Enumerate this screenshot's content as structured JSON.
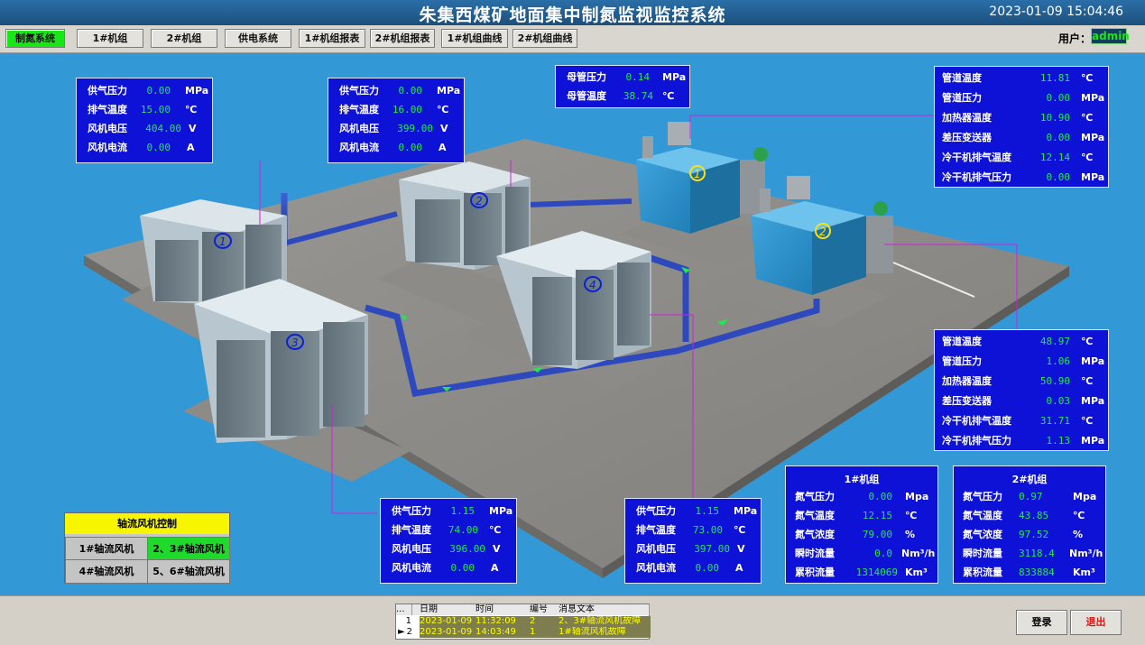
{
  "header": {
    "title": "朱集西煤矿地面集中制氮监视监控系统",
    "clock": "2023-01-09 15:04:46"
  },
  "nav": {
    "items": [
      "制氮系统",
      "1#机组",
      "2#机组",
      "供电系统",
      "1#机组报表",
      "2#机组报表",
      "1#机组曲线",
      "2#机组曲线"
    ],
    "user_label": "用户：",
    "user_value": "admin"
  },
  "compressors": [
    {
      "num": "1",
      "rows": [
        {
          "label": "供气压力",
          "value": "0.00",
          "unit": "MPa"
        },
        {
          "label": "排气温度",
          "value": "15.00",
          "unit": "℃"
        },
        {
          "label": "风机电压",
          "value": "404.00",
          "unit": "V"
        },
        {
          "label": "风机电流",
          "value": "0.00",
          "unit": "A"
        }
      ]
    },
    {
      "num": "2",
      "rows": [
        {
          "label": "供气压力",
          "value": "0.00",
          "unit": "MPa"
        },
        {
          "label": "排气温度",
          "value": "16.00",
          "unit": "℃"
        },
        {
          "label": "风机电压",
          "value": "399.00",
          "unit": "V"
        },
        {
          "label": "风机电流",
          "value": "0.00",
          "unit": "A"
        }
      ]
    },
    {
      "num": "3",
      "rows": [
        {
          "label": "供气压力",
          "value": "1.15",
          "unit": "MPa"
        },
        {
          "label": "排气温度",
          "value": "74.00",
          "unit": "℃"
        },
        {
          "label": "风机电压",
          "value": "396.00",
          "unit": "V"
        },
        {
          "label": "风机电流",
          "value": "0.00",
          "unit": "A"
        }
      ]
    },
    {
      "num": "4",
      "rows": [
        {
          "label": "供气压力",
          "value": "1.15",
          "unit": "MPa"
        },
        {
          "label": "排气温度",
          "value": "73.00",
          "unit": "℃"
        },
        {
          "label": "风机电压",
          "value": "397.00",
          "unit": "V"
        },
        {
          "label": "风机电流",
          "value": "0.00",
          "unit": "A"
        }
      ]
    }
  ],
  "main_pipe": {
    "rows": [
      {
        "label": "母管压力",
        "value": "0.14",
        "unit": "MPa"
      },
      {
        "label": "母管温度",
        "value": "38.74",
        "unit": "℃"
      }
    ]
  },
  "generators": [
    {
      "num": "1",
      "rows": [
        {
          "label": "管道温度",
          "value": "11.81",
          "unit": "℃"
        },
        {
          "label": "管道压力",
          "value": "0.00",
          "unit": "MPa"
        },
        {
          "label": "加热器温度",
          "value": "10.90",
          "unit": "℃"
        },
        {
          "label": "差压变送器",
          "value": "0.00",
          "unit": "MPa"
        },
        {
          "label": "冷干机排气温度",
          "value": "12.14",
          "unit": "℃"
        },
        {
          "label": "冷干机排气压力",
          "value": "0.00",
          "unit": "MPa"
        }
      ]
    },
    {
      "num": "2",
      "rows": [
        {
          "label": "管道温度",
          "value": "48.97",
          "unit": "℃"
        },
        {
          "label": "管道压力",
          "value": "1.06",
          "unit": "MPa"
        },
        {
          "label": "加热器温度",
          "value": "50.90",
          "unit": "℃"
        },
        {
          "label": "差压变送器",
          "value": "0.03",
          "unit": "MPa"
        },
        {
          "label": "冷干机排气温度",
          "value": "31.71",
          "unit": "℃"
        },
        {
          "label": "冷干机排气压力",
          "value": "1.13",
          "unit": "MPa"
        }
      ]
    }
  ],
  "units": [
    {
      "title": "1#机组",
      "rows": [
        {
          "label": "氮气压力",
          "value": "0.00",
          "unit": "Mpa"
        },
        {
          "label": "氮气温度",
          "value": "12.15",
          "unit": "℃"
        },
        {
          "label": "氮气浓度",
          "value": "79.00",
          "unit": "%"
        },
        {
          "label": "瞬时流量",
          "value": "0.0",
          "unit": "Nm³/h"
        },
        {
          "label": "累积流量",
          "value": "1314069",
          "unit": "Km³"
        }
      ]
    },
    {
      "title": "2#机组",
      "rows": [
        {
          "label": "氮气压力",
          "value": "0.97",
          "unit": "Mpa"
        },
        {
          "label": "氮气温度",
          "value": "43.85",
          "unit": "℃"
        },
        {
          "label": "氮气浓度",
          "value": "97.52",
          "unit": "%"
        },
        {
          "label": "瞬时流量",
          "value": "3118.4",
          "unit": "Nm³/h"
        },
        {
          "label": "累积流量",
          "value": "833884",
          "unit": "Km³"
        }
      ]
    }
  ],
  "fan_control": {
    "title": "轴流风机控制",
    "buttons": [
      {
        "label": "1#轴流风机",
        "on": false
      },
      {
        "label": "2、3#轴流风机",
        "on": true
      },
      {
        "label": "4#轴流风机",
        "on": false
      },
      {
        "label": "5、6#轴流风机",
        "on": false
      }
    ]
  },
  "alarm": {
    "headers": [
      "...",
      "日期",
      "时间",
      "编号",
      "消息文本"
    ],
    "rows": [
      {
        "idx": "1",
        "date": "2023-01-09",
        "time": "11:32:09",
        "code": "2",
        "text": "2、3#轴流风机故障"
      },
      {
        "idx": "2",
        "date": "2023-01-09",
        "time": "14:03:49",
        "code": "1",
        "text": "1#轴流风机故障"
      }
    ]
  },
  "buttons": {
    "login": "登录",
    "exit": "退出"
  },
  "colors": {
    "stage": "#3298d6",
    "panel": "#0d12d6",
    "value": "#22e84d",
    "active": "#19e619",
    "leader": "#d020e0",
    "flow_arrow": "#22e84d"
  }
}
